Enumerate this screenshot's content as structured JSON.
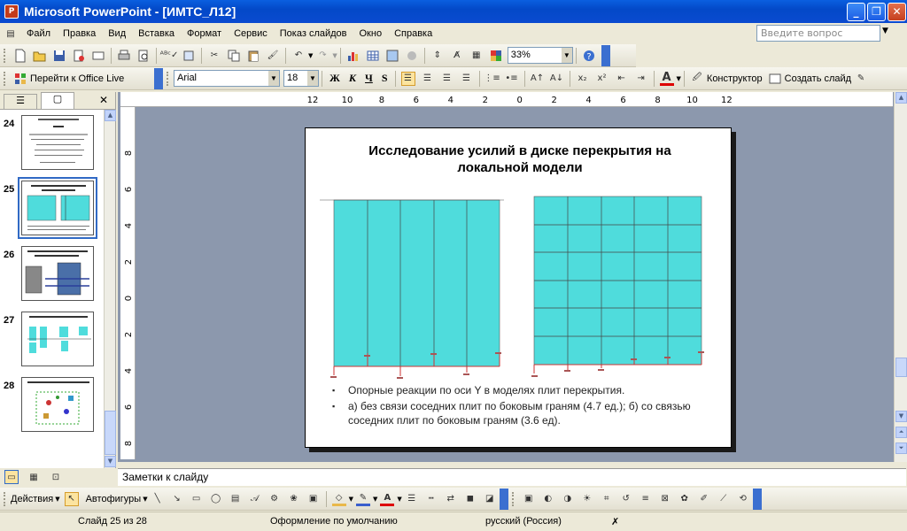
{
  "window": {
    "title": "Microsoft PowerPoint - [ИМТС_Л12]",
    "app_icon": "P"
  },
  "menu": {
    "items": [
      "Файл",
      "Правка",
      "Вид",
      "Вставка",
      "Формат",
      "Сервис",
      "Показ слайдов",
      "Окно",
      "Справка"
    ],
    "ask_placeholder": "Введите вопрос"
  },
  "toolbar": {
    "zoom": "33%"
  },
  "formatting": {
    "goto_label": "Перейти к Office Live",
    "font": "Arial",
    "size": "18",
    "bold": "Ж",
    "italic": "К",
    "underline": "Ч",
    "shadow": "S",
    "designer": "Конструктор",
    "new_slide": "Создать слайд"
  },
  "ruler": {
    "h_labels": [
      "12",
      "10",
      "8",
      "6",
      "4",
      "2",
      "0",
      "2",
      "4",
      "6",
      "8",
      "10",
      "12"
    ],
    "v_labels": [
      "8",
      "6",
      "4",
      "2",
      "0",
      "2",
      "4",
      "6",
      "8"
    ]
  },
  "slides_pane": {
    "thumbnails": [
      {
        "num": "24"
      },
      {
        "num": "25",
        "selected": true
      },
      {
        "num": "26"
      },
      {
        "num": "27"
      },
      {
        "num": "28"
      }
    ]
  },
  "slide": {
    "title": "Исследование усилий в диске перекрытия на локальной модели",
    "bullets": [
      "Опорные реакции по оси Y в моделях плит перекрытия.",
      "а) без связи соседних плит по боковым граням (4.7 ед.); б) со связью соседних плит по боковым граням (3.6 ед)."
    ],
    "fill_color": "#4fdcdc"
  },
  "notes": {
    "placeholder": "Заметки к слайду"
  },
  "drawing": {
    "actions": "Действия",
    "autoshapes": "Автофигуры"
  },
  "status": {
    "slide": "Слайд 25 из 28",
    "design": "Оформление по умолчанию",
    "language": "русский (Россия)"
  }
}
